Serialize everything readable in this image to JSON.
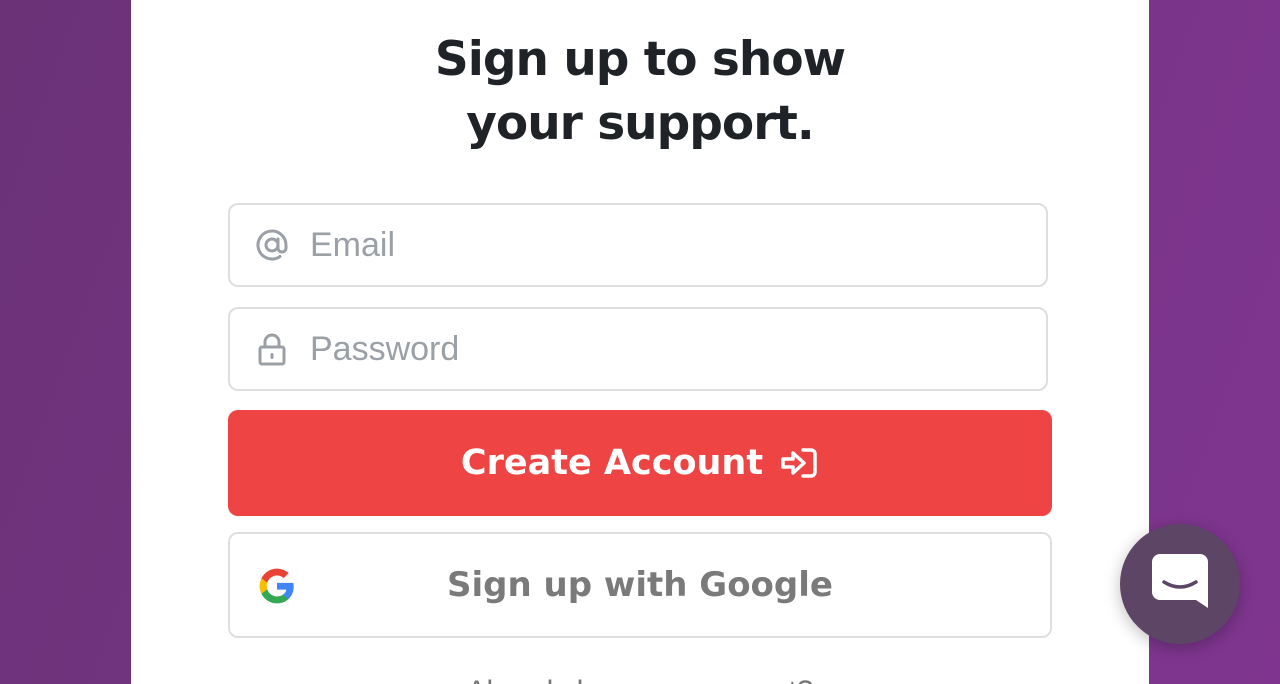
{
  "signup": {
    "title_line1": "Sign up to show",
    "title_line2": "your support.",
    "email": {
      "placeholder": "Email",
      "value": "",
      "icon": "at-icon"
    },
    "password": {
      "placeholder": "Password",
      "value": "",
      "icon": "lock-icon"
    },
    "create_account_label": "Create Account",
    "create_account_icon": "sign-in-icon",
    "google_label": "Sign up with Google",
    "google_icon": "google-icon",
    "cutoff_text": "Already have an account?"
  },
  "colors": {
    "background_purple": "#763585",
    "primary_button": "#ef4444",
    "chat_bubble": "#5d4565",
    "title_text": "#1f2328"
  },
  "chat": {
    "icon": "chat-icon"
  }
}
